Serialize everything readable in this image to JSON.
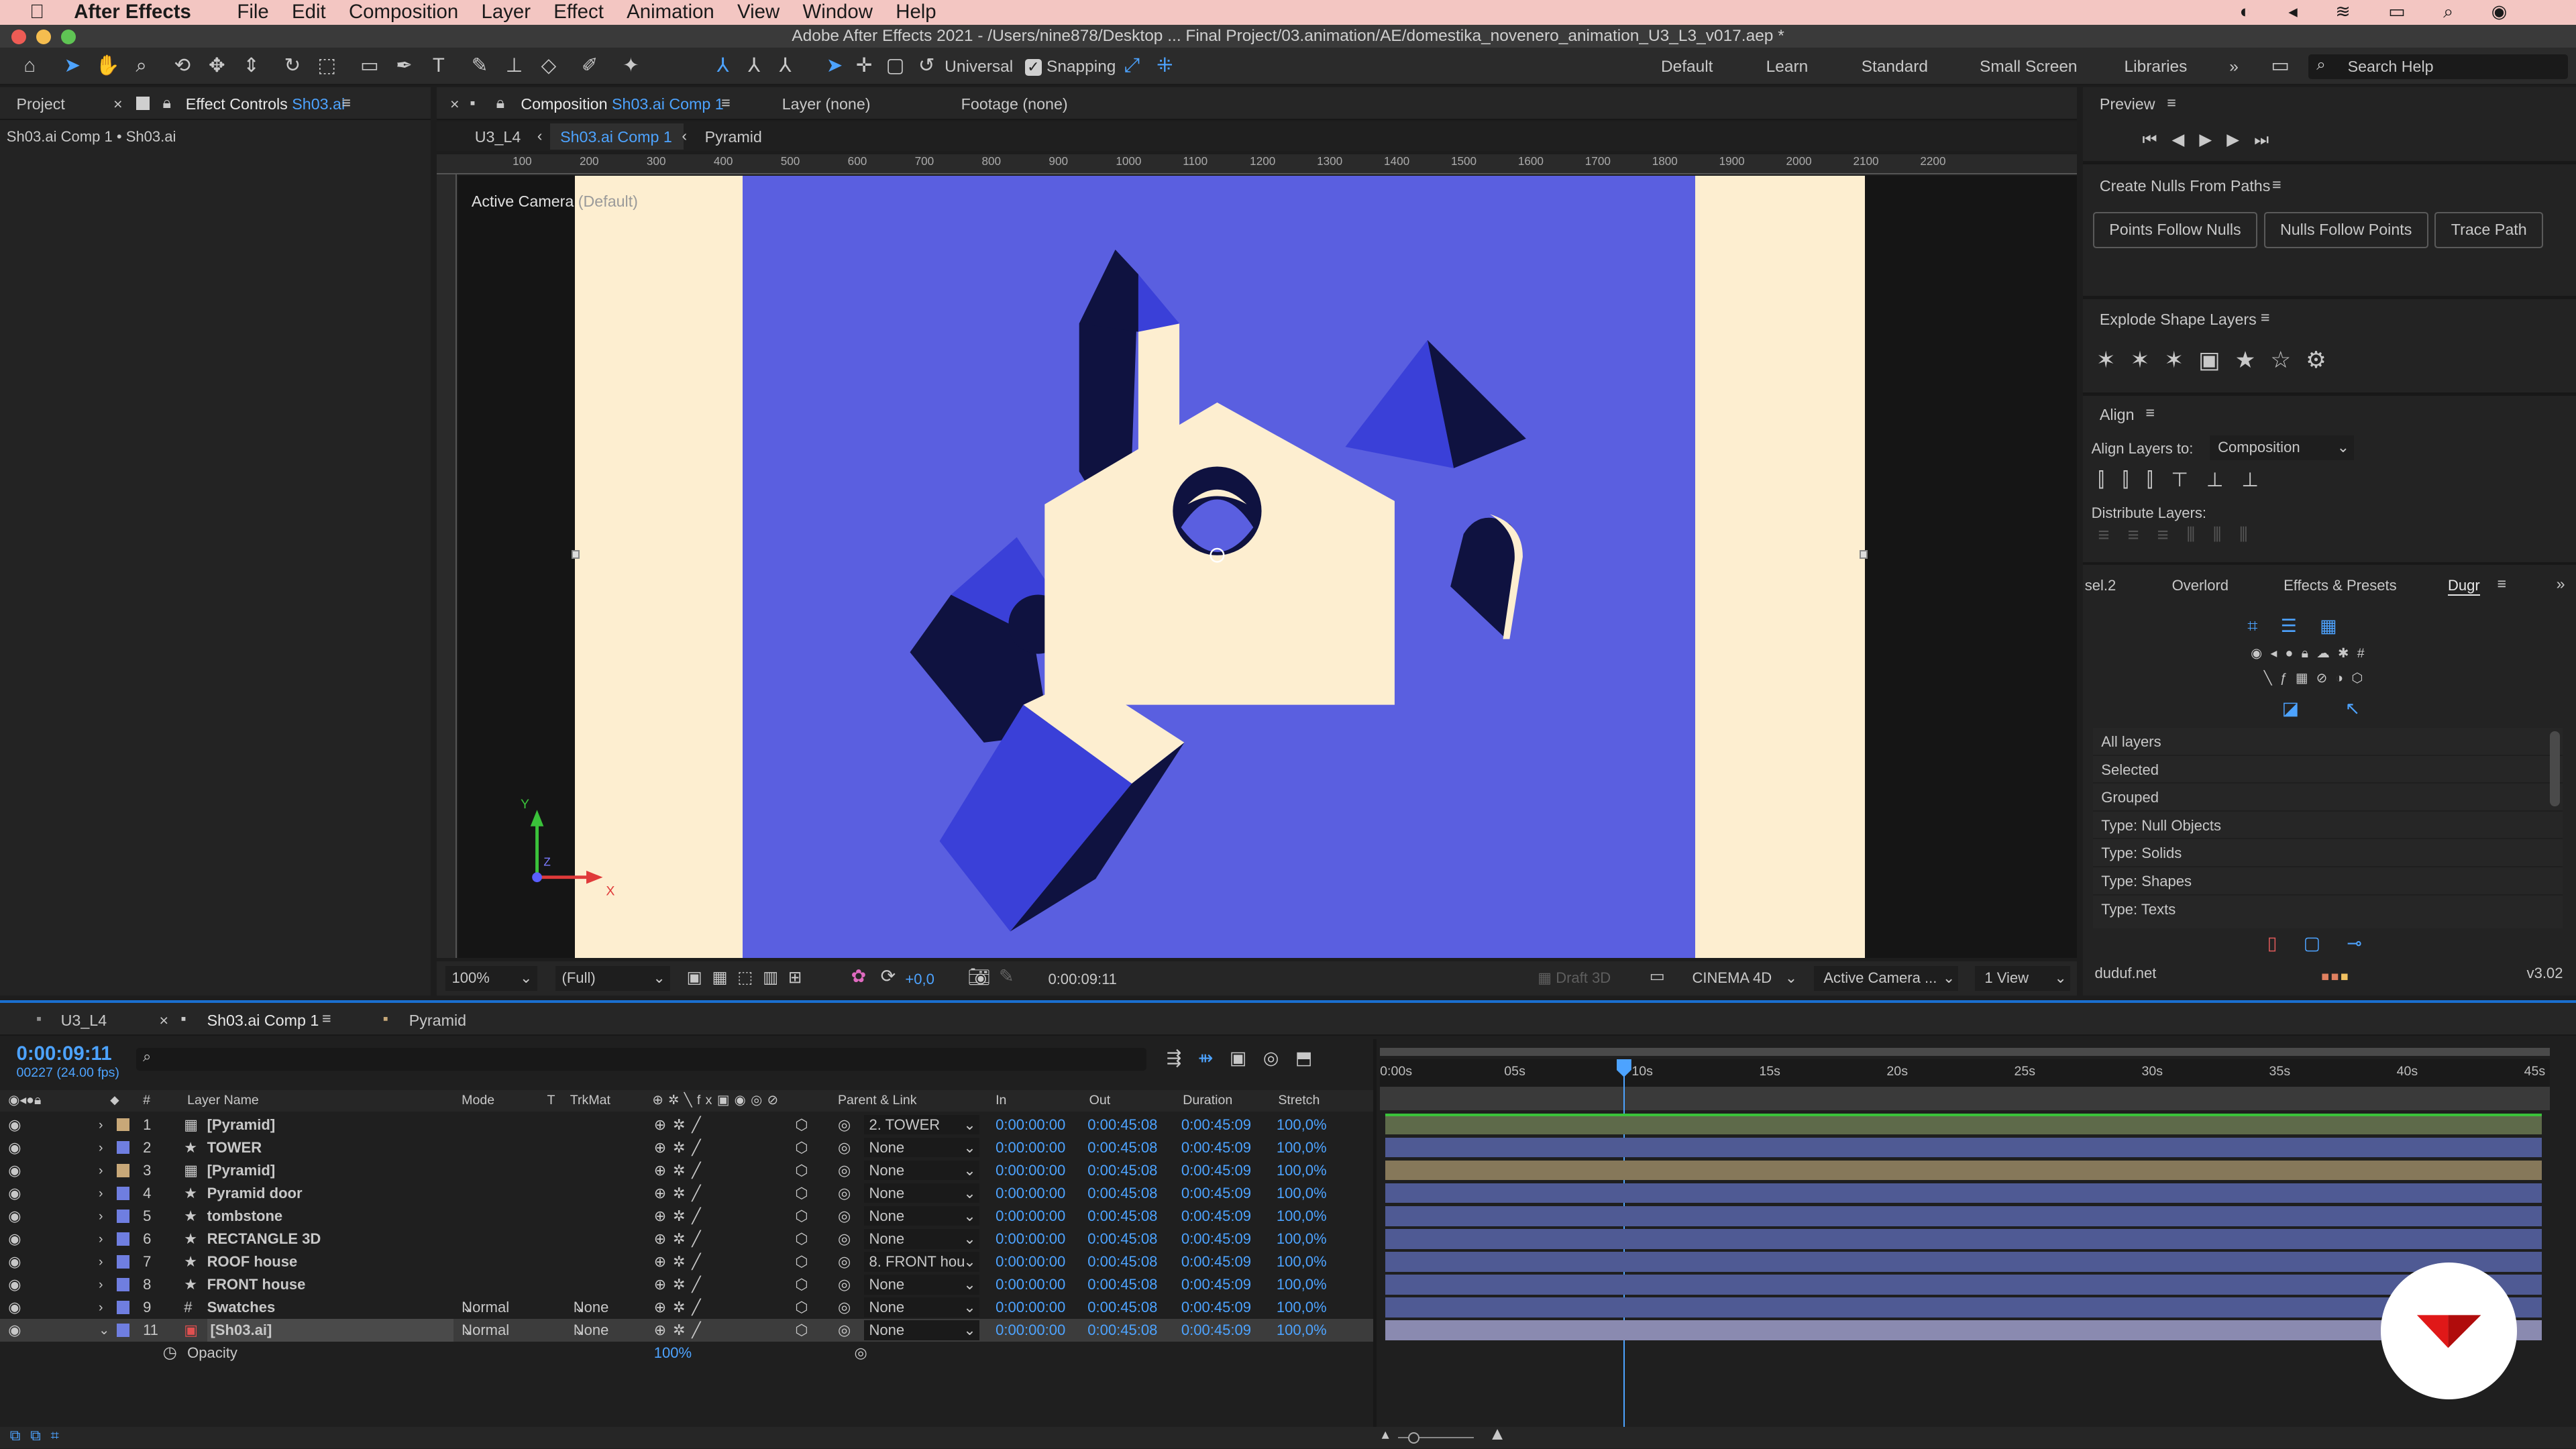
{
  "menubar": {
    "app": "After Effects",
    "items": [
      "File",
      "Edit",
      "Composition",
      "Layer",
      "Effect",
      "Animation",
      "View",
      "Window",
      "Help"
    ]
  },
  "window_title": "Adobe After Effects 2021 - /Users/nine878/Desktop ... Final Project/03.animation/AE/domestika_novenero_animation_U3_L3_v017.aep *",
  "toolbar": {
    "universal": "Universal",
    "snapping": "Snapping",
    "workspaces": [
      "Default",
      "Learn",
      "Standard",
      "Small Screen",
      "Libraries"
    ],
    "search_placeholder": "Search Help"
  },
  "left_panel": {
    "tab_project": "Project",
    "tab_effect_controls": "Effect Controls",
    "effect_controls_target": "Sh03.ai",
    "breadcrumb": "Sh03.ai Comp 1 • Sh03.ai"
  },
  "comp_panel": {
    "tab_label": "Composition",
    "tab_comp": "Sh03.ai Comp 1",
    "layer_tab": "Layer (none)",
    "footage_tab": "Footage (none)",
    "nav": [
      "U3_L4",
      "Sh03.ai Comp 1",
      "Pyramid"
    ],
    "ruler_marks": [
      "100",
      "200",
      "300",
      "400",
      "500",
      "600",
      "700",
      "800",
      "900",
      "1000",
      "1100",
      "1200",
      "1300",
      "1400",
      "1500",
      "1600",
      "1700",
      "1800",
      "1900",
      "2000",
      "2100",
      "2200"
    ],
    "camera_label": "Active Camera",
    "camera_sub": "(Default)",
    "axis_y": "Y",
    "axis_x": "X",
    "axis_z": "Z",
    "zoom": "100%",
    "resolution": "(Full)",
    "exposure": "+0,0",
    "timecode": "0:00:09:11",
    "draft3d": "Draft 3D",
    "renderer": "CINEMA 4D",
    "camera_select": "Active Camera ...",
    "views": "1 View",
    "colors": {
      "bg": "#5a5fe0",
      "canvas": "#fdeed0",
      "dark": "#0f1240",
      "mid": "#3a40d8"
    }
  },
  "right_panel": {
    "preview_title": "Preview",
    "nulls_title": "Create Nulls From Paths",
    "nulls_buttons": [
      "Points Follow Nulls",
      "Nulls Follow Points",
      "Trace Path"
    ],
    "explode_title": "Explode Shape Layers",
    "align_title": "Align",
    "align_to_label": "Align Layers to:",
    "align_to_value": "Composition",
    "distribute_label": "Distribute Layers:",
    "tabs": [
      "sel.2",
      "Overlord",
      "Effects & Presets",
      "Dugr"
    ],
    "dugr_list": [
      "All layers",
      "Selected",
      "Grouped",
      "Type: Null Objects",
      "Type: Solids",
      "Type: Shapes",
      "Type: Texts"
    ],
    "footer_left": "duduf.net",
    "footer_right": "v3.02"
  },
  "timeline": {
    "tabs": [
      "U3_L4",
      "Sh03.ai Comp 1",
      "Pyramid"
    ],
    "current_time": "0:00:09:11",
    "frame_info": "00227 (24.00 fps)",
    "columns": {
      "num": "#",
      "name": "Layer Name",
      "mode": "Mode",
      "t": "T",
      "trkmat": "TrkMat",
      "parent": "Parent & Link",
      "in": "In",
      "out": "Out",
      "duration": "Duration",
      "stretch": "Stretch"
    },
    "ruler": [
      "0:00s",
      "05s",
      "10s",
      "15s",
      "20s",
      "25s",
      "30s",
      "35s",
      "40s",
      "45s"
    ],
    "layers": [
      {
        "num": "1",
        "name": "[Pyramid]",
        "type": "comp",
        "color": "#c8a878",
        "parent": "2. TOWER",
        "in": "0:00:00:00",
        "out": "0:00:45:08",
        "duration": "0:00:45:09",
        "stretch": "100,0%"
      },
      {
        "num": "2",
        "name": "TOWER",
        "type": "shape",
        "color": "#6f7ee0",
        "parent": "None",
        "in": "0:00:00:00",
        "out": "0:00:45:08",
        "duration": "0:00:45:09",
        "stretch": "100,0%"
      },
      {
        "num": "3",
        "name": "[Pyramid]",
        "type": "comp",
        "color": "#c8a878",
        "parent": "None",
        "in": "0:00:00:00",
        "out": "0:00:45:08",
        "duration": "0:00:45:09",
        "stretch": "100,0%"
      },
      {
        "num": "4",
        "name": "Pyramid door",
        "type": "shape",
        "color": "#6f7ee0",
        "parent": "None",
        "in": "0:00:00:00",
        "out": "0:00:45:08",
        "duration": "0:00:45:09",
        "stretch": "100,0%"
      },
      {
        "num": "5",
        "name": "tombstone",
        "type": "shape",
        "color": "#6f7ee0",
        "parent": "None",
        "in": "0:00:00:00",
        "out": "0:00:45:08",
        "duration": "0:00:45:09",
        "stretch": "100,0%"
      },
      {
        "num": "6",
        "name": "RECTANGLE 3D",
        "type": "shape",
        "color": "#6f7ee0",
        "parent": "None",
        "in": "0:00:00:00",
        "out": "0:00:45:08",
        "duration": "0:00:45:09",
        "stretch": "100,0%"
      },
      {
        "num": "7",
        "name": "ROOF house",
        "type": "shape",
        "color": "#6f7ee0",
        "parent": "8. FRONT hou",
        "in": "0:00:00:00",
        "out": "0:00:45:08",
        "duration": "0:00:45:09",
        "stretch": "100,0%"
      },
      {
        "num": "8",
        "name": "FRONT house",
        "type": "shape",
        "color": "#6f7ee0",
        "parent": "None",
        "in": "0:00:00:00",
        "out": "0:00:45:08",
        "duration": "0:00:45:09",
        "stretch": "100,0%"
      },
      {
        "num": "9",
        "name": "Swatches",
        "type": "grid",
        "color": "#6f7ee0",
        "mode": "Normal",
        "trkmat": "None",
        "parent": "None",
        "in": "0:00:00:00",
        "out": "0:00:45:08",
        "duration": "0:00:45:09",
        "stretch": "100,0%"
      },
      {
        "num": "11",
        "name": "[Sh03.ai]",
        "type": "ai",
        "color": "#6f7ee0",
        "mode": "Normal",
        "trkmat": "None",
        "parent": "None",
        "in": "0:00:00:00",
        "out": "0:00:45:08",
        "duration": "0:00:45:09",
        "stretch": "100,0%"
      }
    ],
    "opacity_label": "Opacity",
    "opacity_value": "100%"
  }
}
